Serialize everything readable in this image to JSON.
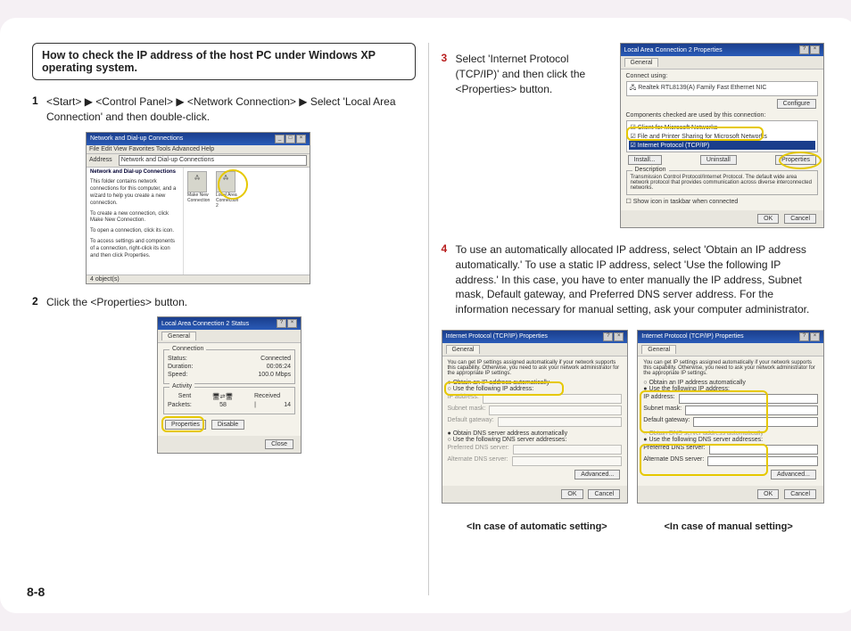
{
  "page_number": "8-8",
  "heading": "How to check the IP address of the host PC under Windows XP operating system.",
  "steps": {
    "s1": {
      "num": "1",
      "text": "<Start> ▶ <Control Panel> ▶ <Network Connection> ▶ Select 'Local Area Connection' and then double-click."
    },
    "s2": {
      "num": "2",
      "text": "Click the <Properties> button."
    },
    "s3": {
      "num": "3",
      "text": "Select 'Internet Protocol (TCP/IP)' and then click the <Properties> button."
    },
    "s4": {
      "num": "4",
      "text": "To use an automatically allocated IP address, select 'Obtain an IP address automatically.' To use a static IP address, select 'Use the following IP address.' In this case, you have to enter manually the IP address, Subnet mask, Default gateway, and Preferred DNS server address. For the information necessary for manual setting, ask your computer administrator."
    }
  },
  "captions": {
    "auto": "<In case of automatic setting>",
    "manual": "<In case of manual setting>"
  },
  "shot1": {
    "title": "Network and Dial-up Connections",
    "menu": "File  Edit  View  Favorites  Tools  Advanced  Help",
    "addr_label": "Address",
    "addr_val": "Network and Dial-up Connections",
    "heading": "Network and Dial-up Connections",
    "body1": "This folder contains network connections for this computer, and a wizard to help you create a new connection.",
    "body2": "To create a new connection, click Make New Connection.",
    "body3": "To open a connection, click its icon.",
    "body4": "To access settings and components of a connection, right-click its icon and then click Properties.",
    "icon1": "Make New Connection",
    "icon2": "Local Area Connection 2",
    "footer": "4 object(s)"
  },
  "shot2": {
    "title": "Local Area Connection 2 Status",
    "tab": "General",
    "conn_label": "Connection",
    "status_l": "Status:",
    "status_v": "Connected",
    "dur_l": "Duration:",
    "dur_v": "00:06:24",
    "speed_l": "Speed:",
    "speed_v": "100.0 Mbps",
    "act_label": "Activity",
    "sent": "Sent",
    "received": "Received",
    "pkt_l": "Packets:",
    "pkt_s": "58",
    "pkt_r": "14",
    "btn_prop": "Properties",
    "btn_dis": "Disable",
    "btn_close": "Close"
  },
  "shot3": {
    "title": "Local Area Connection 2 Properties",
    "tab": "General",
    "connect_using": "Connect using:",
    "nic": "Realtek RTL8139(A) Family Fast Ethernet NIC",
    "btn_conf": "Configure",
    "components": "Components checked are used by this connection:",
    "item1": "Client for Microsoft Networks",
    "item2": "File and Printer Sharing for Microsoft Networks",
    "item3": "Internet Protocol (TCP/IP)",
    "btn_inst": "Install...",
    "btn_unin": "Uninstall",
    "btn_prop": "Properties",
    "desc_l": "Description",
    "desc_v": "Transmission Control Protocol/Internet Protocol. The default wide area network protocol that provides communication across diverse interconnected networks.",
    "show_icon": "Show icon in taskbar when connected",
    "btn_ok": "OK",
    "btn_cancel": "Cancel"
  },
  "shot4": {
    "title": "Internet Protocol (TCP/IP) Properties",
    "tab": "General",
    "intro": "You can get IP settings assigned automatically if your network supports this capability. Otherwise, you need to ask your network administrator for the appropriate IP settings.",
    "r1": "Obtain an IP address automatically",
    "r2": "Use the following IP address:",
    "ip_l": "IP address:",
    "mask_l": "Subnet mask:",
    "gw_l": "Default gateway:",
    "r3": "Obtain DNS server address automatically",
    "r4": "Use the following DNS server addresses:",
    "dns1_l": "Preferred DNS server:",
    "dns2_l": "Alternate DNS server:",
    "btn_adv": "Advanced...",
    "btn_ok": "OK",
    "btn_cancel": "Cancel"
  }
}
